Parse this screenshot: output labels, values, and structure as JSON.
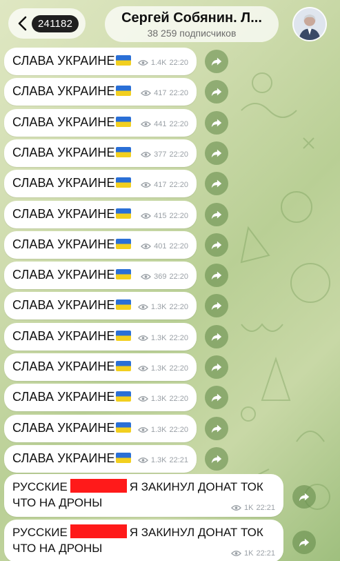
{
  "header": {
    "unread_count": "241182",
    "channel_title": "Сергей Собянин. Л...",
    "subscribers": "38 259 подписчиков"
  },
  "message_text": "СЛАВА УКРАИНЕ",
  "messages": [
    {
      "views": "1.4K",
      "time": "22:20"
    },
    {
      "views": "417",
      "time": "22:20"
    },
    {
      "views": "441",
      "time": "22:20"
    },
    {
      "views": "377",
      "time": "22:20"
    },
    {
      "views": "417",
      "time": "22:20"
    },
    {
      "views": "415",
      "time": "22:20"
    },
    {
      "views": "401",
      "time": "22:20"
    },
    {
      "views": "369",
      "time": "22:20"
    },
    {
      "views": "1.3K",
      "time": "22:20"
    },
    {
      "views": "1.3K",
      "time": "22:20"
    },
    {
      "views": "1.3K",
      "time": "22:20"
    },
    {
      "views": "1.3K",
      "time": "22:20"
    },
    {
      "views": "1.3K",
      "time": "22:20"
    },
    {
      "views": "1.3K",
      "time": "22:21"
    }
  ],
  "long_messages": [
    {
      "line1_start": "РУССКИЕ",
      "line1_end": "Я ЗАКИНУЛ ДОНАТ ТОК",
      "line2": "ЧТО НА ДРОНЫ",
      "views": "1K",
      "time": "22:21"
    },
    {
      "line1_start": "РУССКИЕ",
      "line1_end": "Я ЗАКИНУЛ ДОНАТ ТОК",
      "line2": "ЧТО НА ДРОНЫ",
      "views": "1K",
      "time": "22:21"
    }
  ],
  "colors": {
    "flag_blue": "#2a6fd6",
    "flag_yellow": "#f2cf1f",
    "redaction": "#ff1a1a"
  }
}
